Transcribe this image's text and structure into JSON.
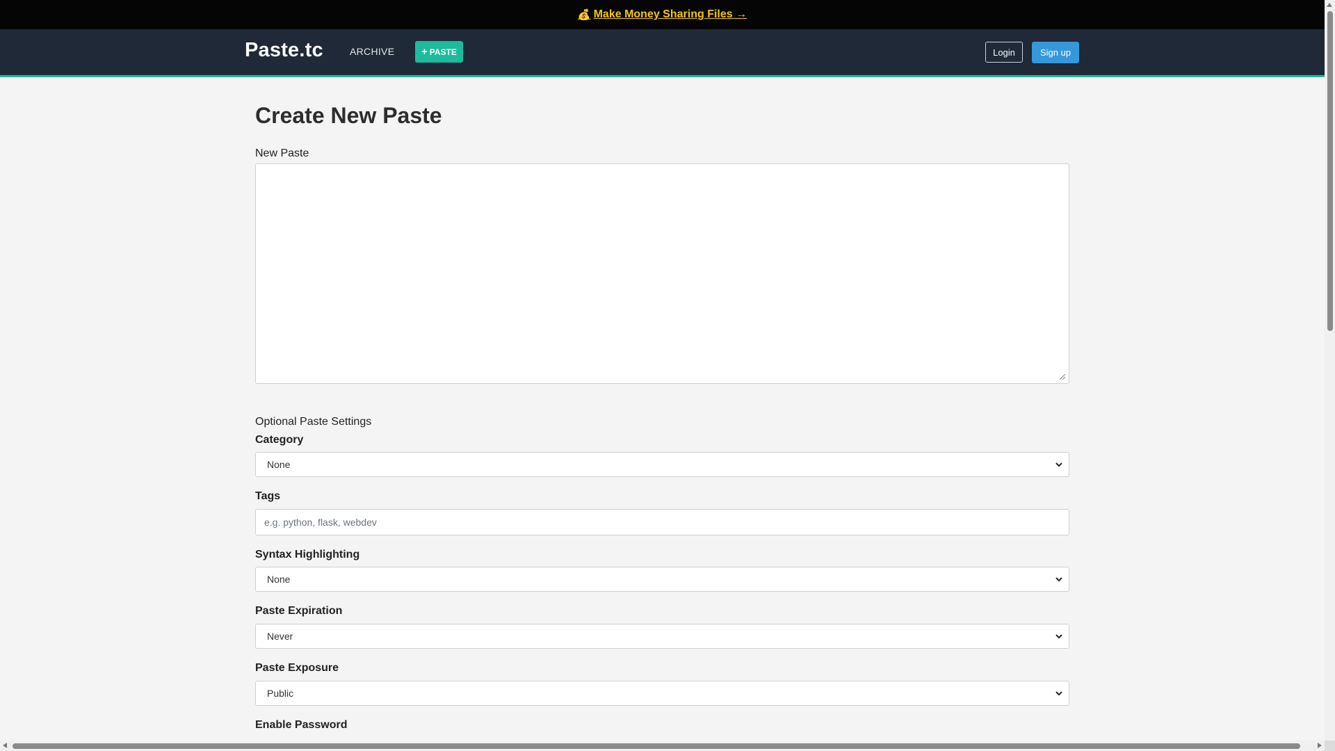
{
  "promo": {
    "icon": "money-bag-icon",
    "text": "Make Money Sharing Files →",
    "bag": "💰",
    "color": "#f5c518"
  },
  "nav": {
    "brand": "Paste.tc",
    "archive": "ARCHIVE",
    "paste_button": "PASTE",
    "paste_plus": "+",
    "login": "Login",
    "signup": "Sign up",
    "accent": "#1abc9c",
    "signup_color": "#3498db",
    "bg": "#1f2937"
  },
  "form": {
    "title": "Create New Paste",
    "paste_label": "New Paste",
    "paste_value": "",
    "optional_heading": "Optional Paste Settings",
    "category": {
      "label": "Category",
      "value": "None"
    },
    "tags": {
      "label": "Tags",
      "value": "",
      "placeholder": "e.g. python, flask, webdev"
    },
    "syntax": {
      "label": "Syntax Highlighting",
      "value": "None"
    },
    "expiration": {
      "label": "Paste Expiration",
      "value": "Never"
    },
    "exposure": {
      "label": "Paste Exposure",
      "value": "Public"
    },
    "password": {
      "label": "Enable Password"
    }
  }
}
